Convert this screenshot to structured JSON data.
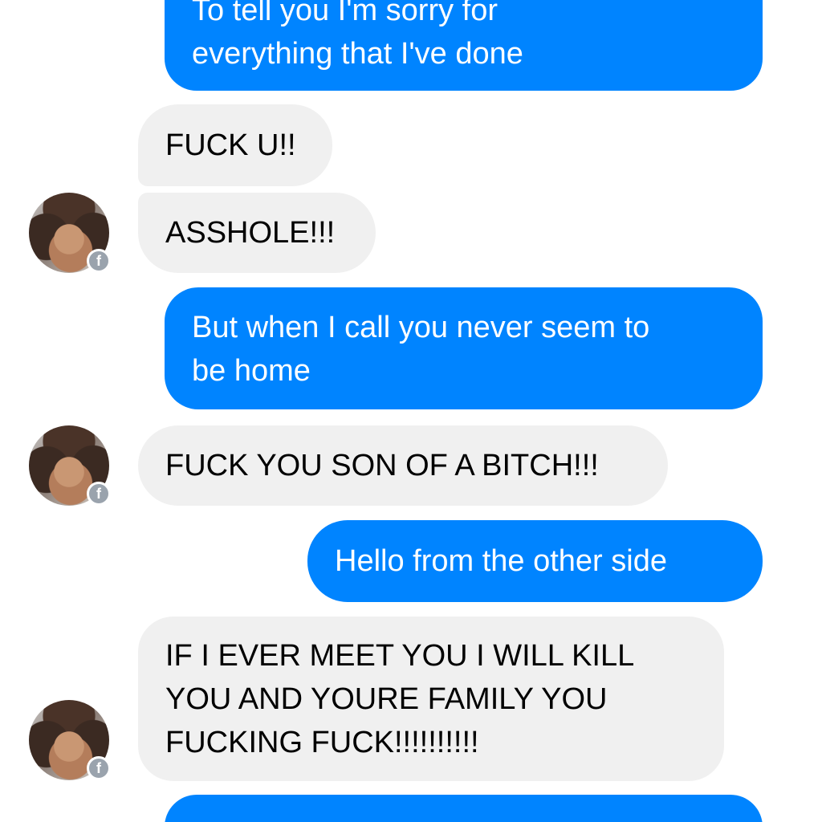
{
  "messages": [
    {
      "sender": "me",
      "text": "To tell you I'm sorry for\neverything that I've done"
    },
    {
      "sender": "them",
      "text": "FUCK U!!"
    },
    {
      "sender": "them",
      "text": "ASSHOLE!!!"
    },
    {
      "sender": "me",
      "text": "But when I call you never seem to\nbe home"
    },
    {
      "sender": "them",
      "text": "FUCK YOU SON OF A BITCH!!!"
    },
    {
      "sender": "me",
      "text": "Hello from the other side"
    },
    {
      "sender": "them",
      "text": "IF I EVER MEET YOU I WILL KILL\nYOU AND YOURE FAMILY YOU\nFUCKING FUCK!!!!!!!!!!"
    },
    {
      "sender": "me",
      "text": ""
    }
  ],
  "avatar": {
    "badge_icon": "facebook-icon",
    "badge_glyph": "f"
  },
  "colors": {
    "sent": "#0084ff",
    "received": "#f0f0f0",
    "badge": "#9aa3ad"
  }
}
